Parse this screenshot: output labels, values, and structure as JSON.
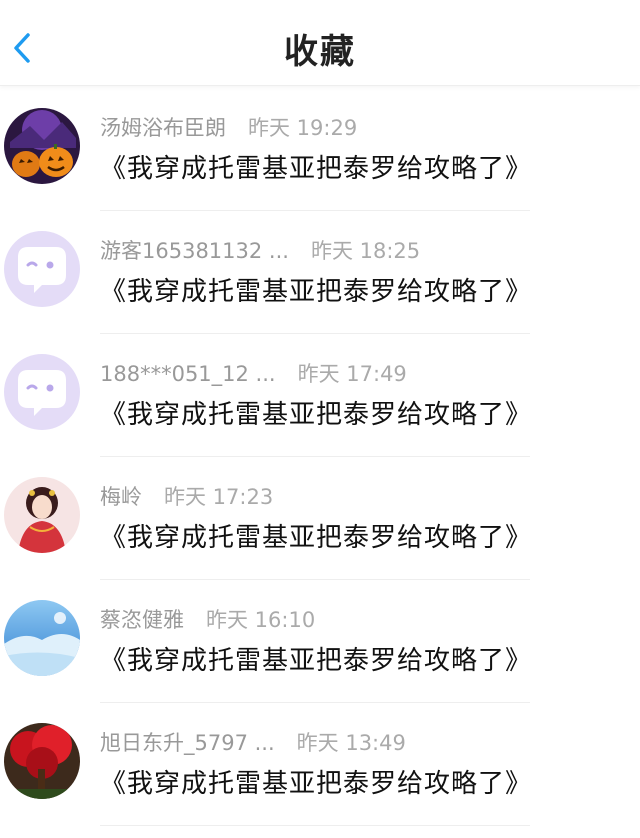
{
  "header": {
    "title": "收藏",
    "back_icon": "chevron-left-icon",
    "accent_color": "#1e9bf0"
  },
  "favorites": [
    {
      "user": "汤姆浴布臣朗",
      "time": "昨天 19:29",
      "book": "《我穿成托雷基亚把泰罗给攻略了》",
      "avatar": "halloween-pumpkin-avatar"
    },
    {
      "user": "游客165381132 ...",
      "time": "昨天 18:25",
      "book": "《我穿成托雷基亚把泰罗给攻略了》",
      "avatar": "default-chat-bubble-avatar"
    },
    {
      "user": "188***051_12 ...",
      "time": "昨天 17:49",
      "book": "《我穿成托雷基亚把泰罗给攻略了》",
      "avatar": "default-chat-bubble-avatar"
    },
    {
      "user": "梅岭",
      "time": "昨天 17:23",
      "book": "《我穿成托雷基亚把泰罗给攻略了》",
      "avatar": "anime-girl-avatar"
    },
    {
      "user": "蔡恣健雅",
      "time": "昨天 16:10",
      "book": "《我穿成托雷基亚把泰罗给攻略了》",
      "avatar": "blue-winter-scene-avatar"
    },
    {
      "user": "旭日东升_5797 ...",
      "time": "昨天 13:49",
      "book": "《我穿成托雷基亚把泰罗给攻略了》",
      "avatar": "red-tree-avatar"
    }
  ]
}
